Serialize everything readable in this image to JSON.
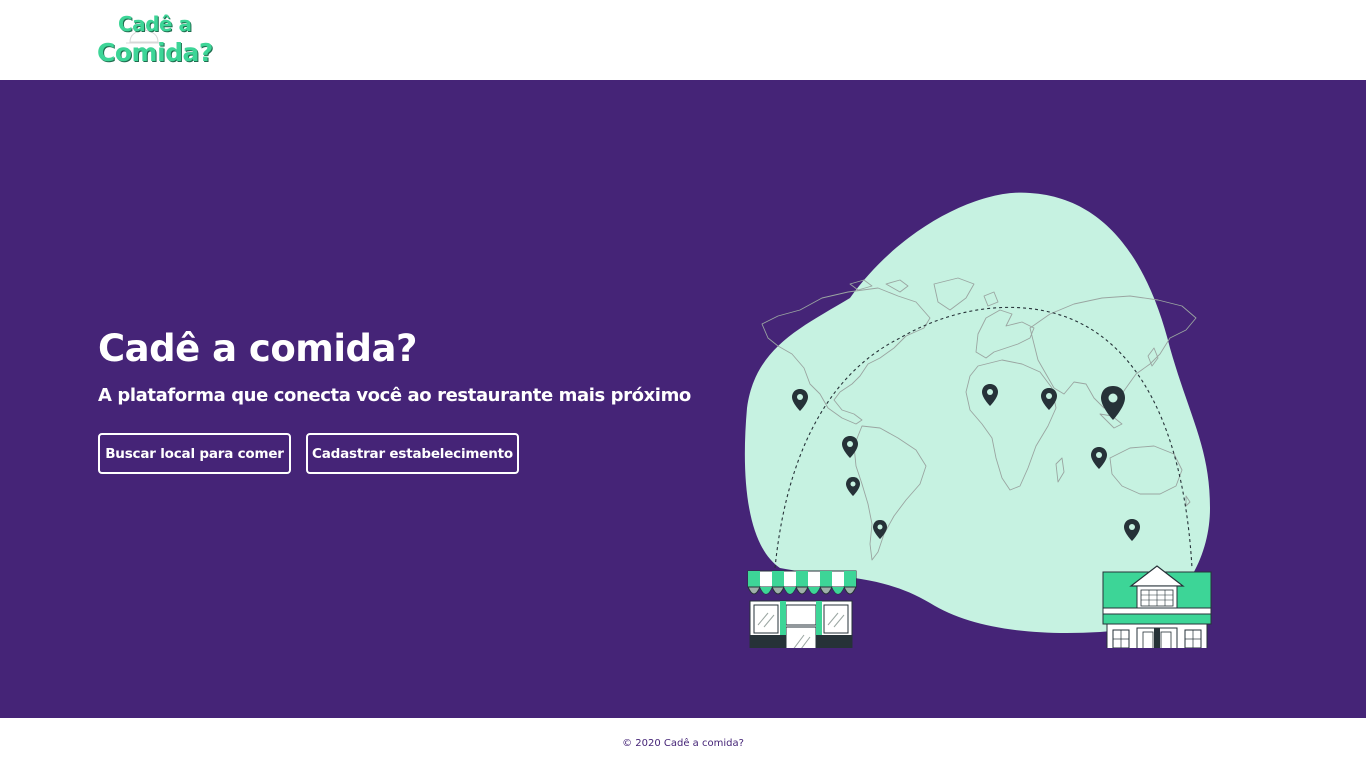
{
  "header": {
    "logo_line1": "Cadê a",
    "logo_line2": "Comida?"
  },
  "hero": {
    "title": "Cadê a comida?",
    "subtitle": "A plataforma que conecta você ao restaurante mais próximo",
    "buttons": {
      "search_label": "Buscar local para comer",
      "register_label": "Cadastrar estabelecimento"
    },
    "illustration": {
      "icons": [
        "world-map",
        "location-pin-icon",
        "store-icon",
        "house-restaurant-icon"
      ]
    }
  },
  "footer": {
    "copyright": "© 2020 Cadê a comida?"
  },
  "colors": {
    "brand_purple": "#452477",
    "brand_green": "#3dd597",
    "blob_mint": "#c6f2e1",
    "dark": "#263238",
    "white": "#ffffff"
  }
}
